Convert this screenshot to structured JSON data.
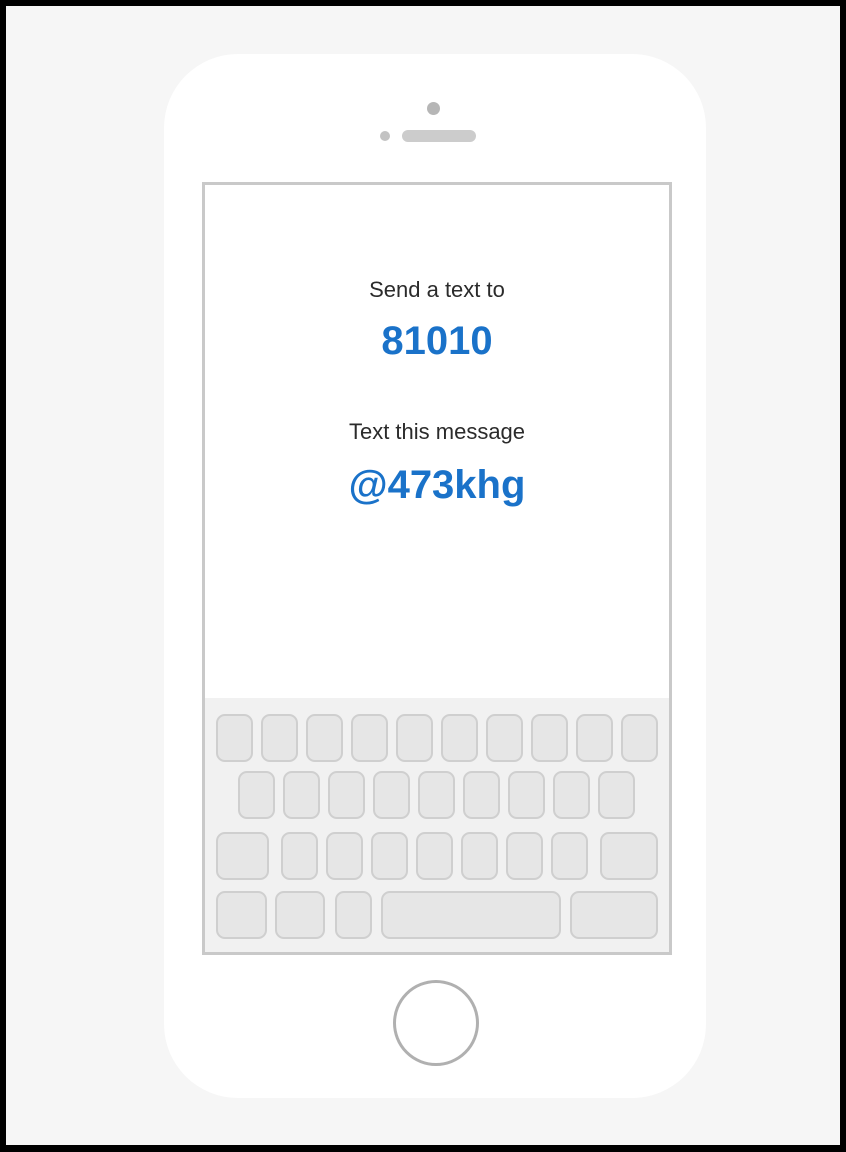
{
  "screen": {
    "send_label": "Send a text to",
    "phone_number": "81010",
    "message_label": "Text this message",
    "message_code": "@473khg"
  },
  "colors": {
    "accent": "#1a72c9",
    "label_text": "#2b2b2b",
    "background": "#f6f6f6",
    "device": "#ffffff",
    "key_fill": "#e6e6e6",
    "key_border": "#cfcfcf"
  },
  "keyboard": {
    "row_key_counts": [
      10,
      9,
      9,
      5
    ]
  },
  "icons": {
    "home_button": "circle-outline"
  }
}
